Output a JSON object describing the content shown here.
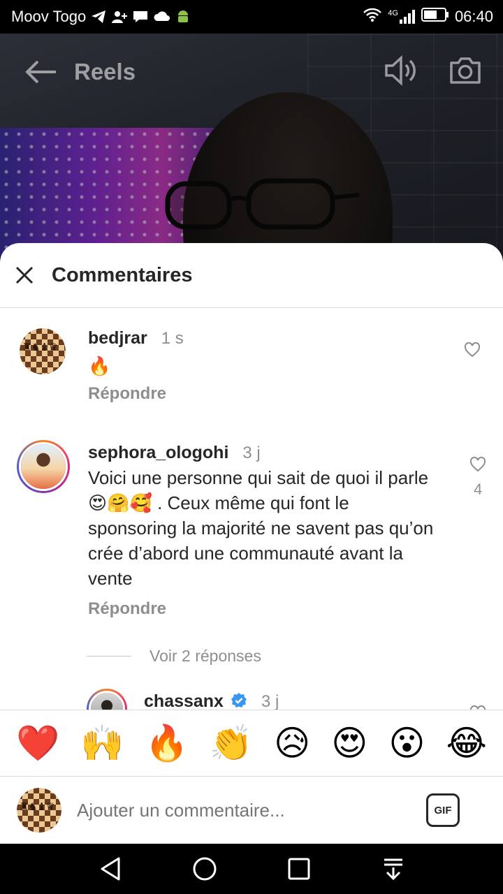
{
  "status_bar": {
    "carrier": "Moov Togo",
    "time": "06:40",
    "network": "4G"
  },
  "reels": {
    "title": "Reels"
  },
  "sheet": {
    "title": "Commentaires"
  },
  "comments": [
    {
      "username": "bedjrar",
      "time": "1 s",
      "text": "🔥",
      "reply_label": "Répondre"
    },
    {
      "username": "sephora_ologohi",
      "time": "3 j",
      "text": "Voici une personne qui sait de quoi il parle 😍🤗🥰 . Ceux même qui font le sponsoring la majorité ne savent pas qu’on crée d’abord une communauté avant la vente",
      "reply_label": "Répondre",
      "like_count": "4"
    }
  ],
  "see_replies": "Voir 2 réponses",
  "reply_comment": {
    "username": "chassanx",
    "time": "3 j"
  },
  "emoji_bar": [
    "❤️",
    "🙌",
    "🔥",
    "👏",
    "😥",
    "😍",
    "😮",
    "😂"
  ],
  "composer": {
    "placeholder": "Ajouter un commentaire...",
    "gif_label": "GIF"
  },
  "colors": {
    "text_primary": "#262626",
    "text_secondary": "#8e8e8e",
    "verified_blue": "#3897f0"
  }
}
